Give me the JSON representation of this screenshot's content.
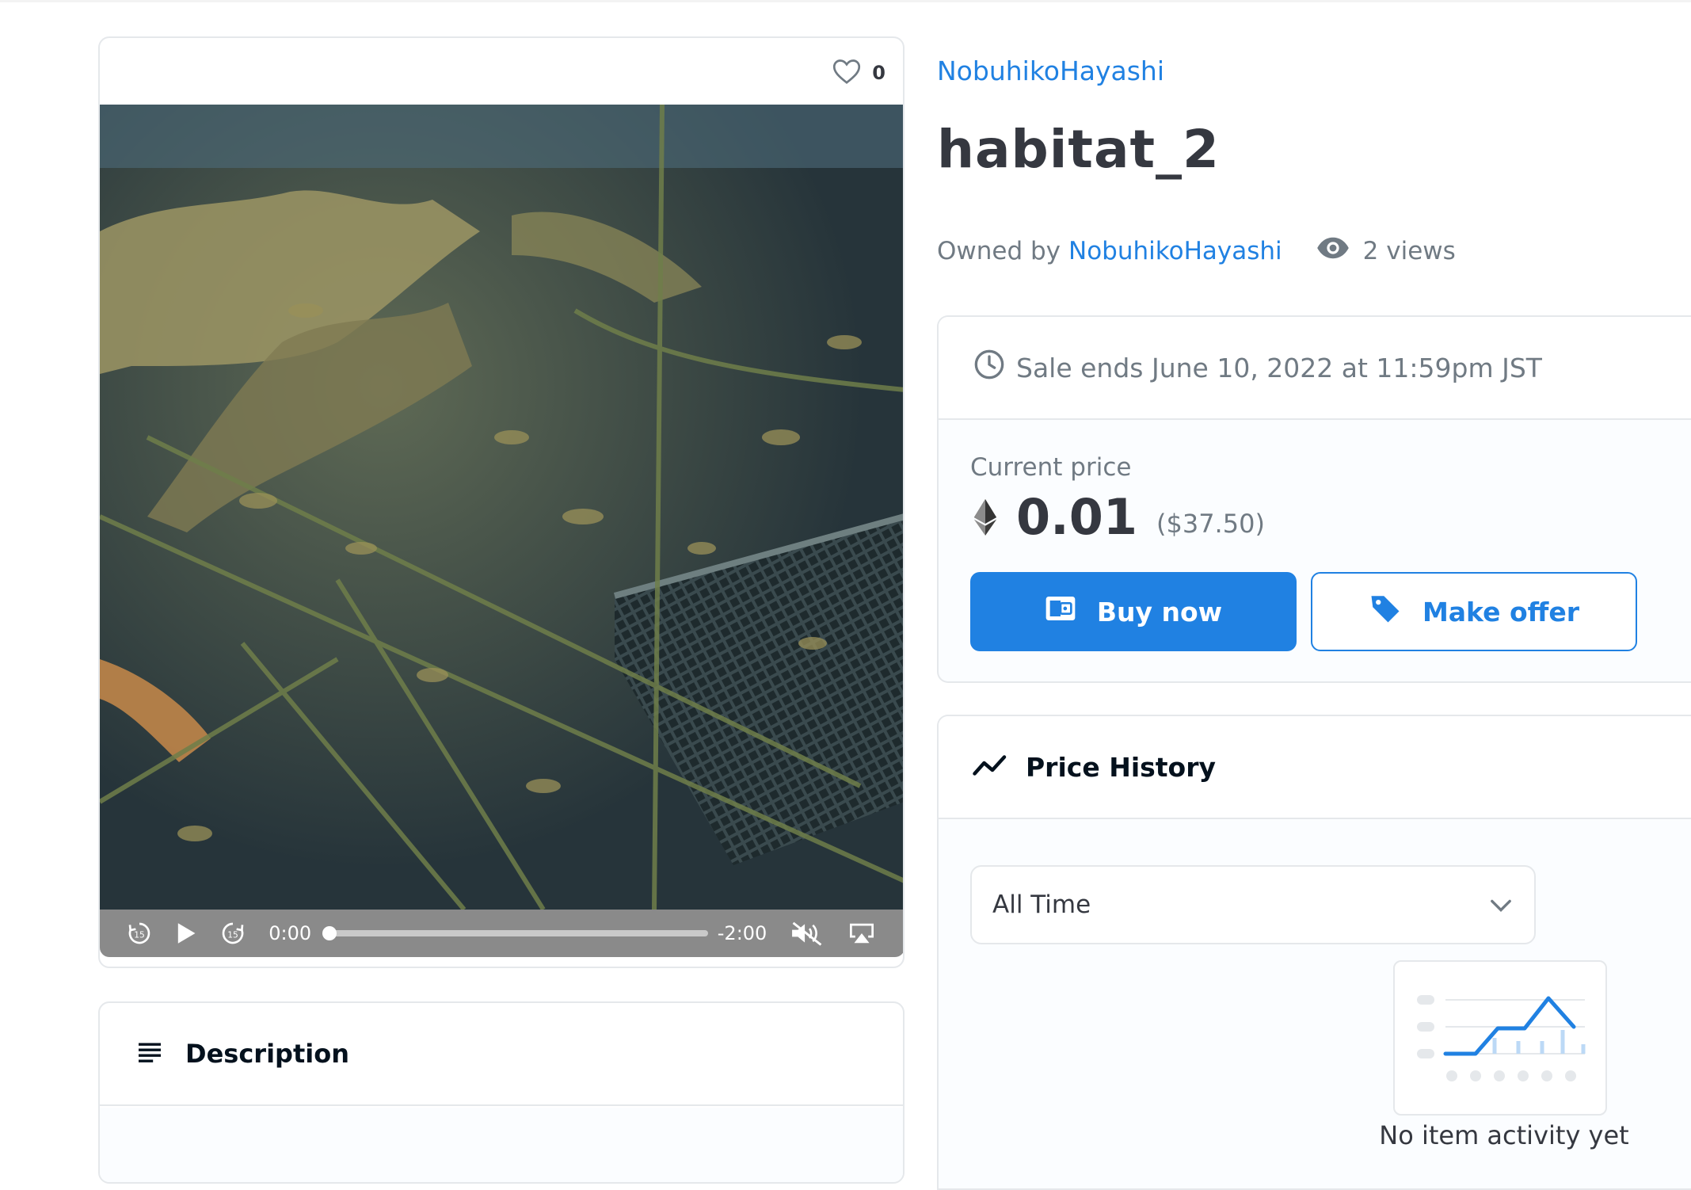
{
  "item": {
    "favorites_count": "0",
    "creator": "NobuhikoHayashi",
    "title": "habitat_2",
    "owned_by_label": "Owned by",
    "owner": "NobuhikoHayashi",
    "views": "2 views"
  },
  "player": {
    "current_time": "0:00",
    "remaining_time": "-2:00",
    "progress": 0
  },
  "description": {
    "title": "Description"
  },
  "sale": {
    "ends_text": "Sale ends June 10, 2022 at 11:59pm JST",
    "current_price_label": "Current price",
    "price": "0.01",
    "price_usd": "($37.50)",
    "buy_label": "Buy now",
    "offer_label": "Make offer"
  },
  "price_history": {
    "title": "Price History",
    "filter": "All Time",
    "empty_text": "No item activity yet"
  },
  "colors": {
    "accent": "#2081e2",
    "text": "#353840",
    "muted": "#707a83",
    "border": "#e5e8eb"
  }
}
